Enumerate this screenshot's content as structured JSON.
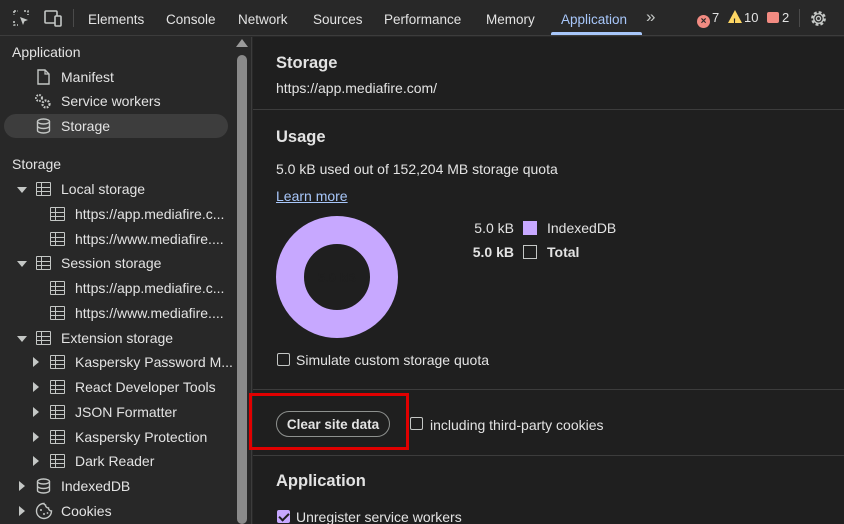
{
  "toolbar": {
    "tabs": [
      "Elements",
      "Console",
      "Network",
      "Sources",
      "Performance",
      "Memory",
      "Application"
    ],
    "active_tab": "Application",
    "more_tabs": "»",
    "errors": "7",
    "warnings": "10",
    "issues": "2"
  },
  "sidebar": {
    "application_header": "Application",
    "application_items": [
      "Manifest",
      "Service workers",
      "Storage"
    ],
    "selected": "Storage",
    "storage_header": "Storage",
    "local_storage": "Local storage",
    "local_storage_children": [
      "https://app.mediafire.c...",
      "https://www.mediafire...."
    ],
    "session_storage": "Session storage",
    "session_storage_children": [
      "https://app.mediafire.c...",
      "https://www.mediafire...."
    ],
    "extension_storage": "Extension storage",
    "extension_storage_children": [
      "Kaspersky Password M...",
      "React Developer Tools",
      "JSON Formatter",
      "Kaspersky Protection",
      "Dark Reader"
    ],
    "indexeddb": "IndexedDB",
    "cookies": "Cookies"
  },
  "main": {
    "title": "Storage",
    "origin": "https://app.mediafire.com/",
    "usage_title": "Usage",
    "usage_text": "5.0 kB used out of 152,204 MB storage quota",
    "learn_more": "Learn more",
    "donut_label": "5.0 kB",
    "legend": [
      {
        "value": "5.0 kB",
        "label": "IndexedDB",
        "color": "#c7a8ff",
        "bold": false
      },
      {
        "value": "5.0 kB",
        "label": "Total",
        "color": "transparent",
        "bold": true
      }
    ],
    "simulate_quota": "Simulate custom storage quota",
    "clear_button": "Clear site data",
    "third_party": "including third-party cookies",
    "application_title": "Application",
    "unregister": "Unregister service workers"
  },
  "colors": {
    "accent": "#a8c7fa",
    "donut": "#c7a8ff",
    "highlight_box": "#e00000"
  }
}
